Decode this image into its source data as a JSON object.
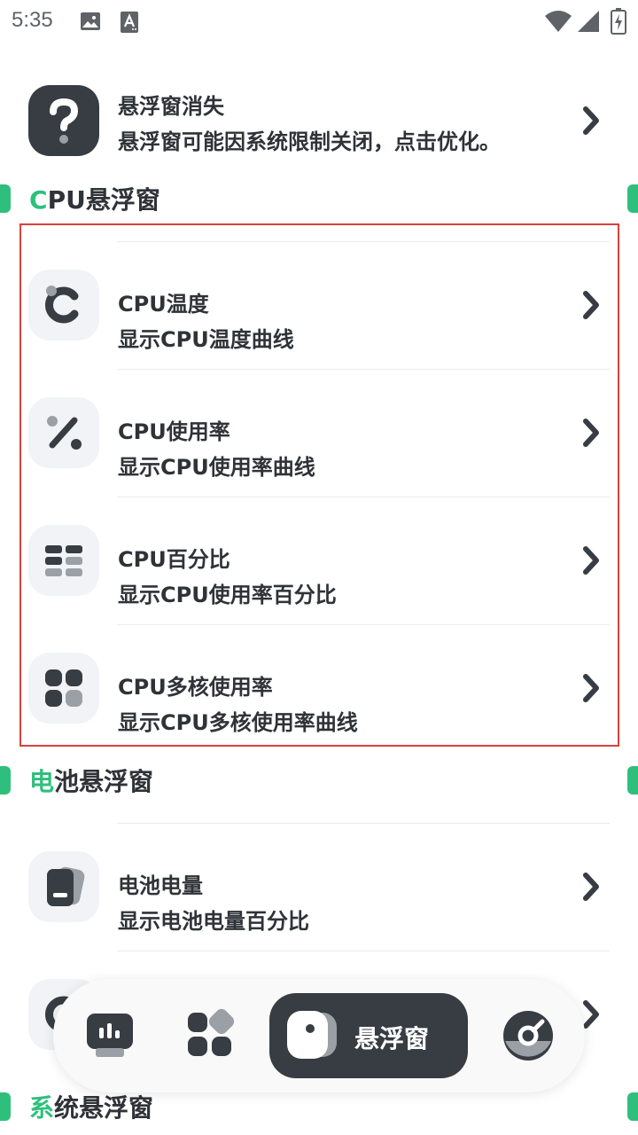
{
  "status_bar": {
    "time": "5:35"
  },
  "top_notice": {
    "title": "悬浮窗消失",
    "subtitle": "悬浮窗可能因系统限制关闭，点击优化。"
  },
  "sections": {
    "cpu": {
      "title_accent": "C",
      "title_rest": "PU悬浮窗",
      "items": [
        {
          "title": "CPU温度",
          "subtitle": "显示CPU温度曲线",
          "icon": "cpu-temperature-icon"
        },
        {
          "title": "CPU使用率",
          "subtitle": "显示CPU使用率曲线",
          "icon": "percent-icon"
        },
        {
          "title": "CPU百分比",
          "subtitle": "显示CPU使用率百分比",
          "icon": "list-grid-icon"
        },
        {
          "title": "CPU多核使用率",
          "subtitle": "显示CPU多核使用率曲线",
          "icon": "multi-core-icon"
        }
      ]
    },
    "battery": {
      "title_accent": "电",
      "title_rest": "池悬浮窗",
      "items": [
        {
          "title": "电池电量",
          "subtitle": "显示电池电量百分比",
          "icon": "battery-icon"
        }
      ]
    },
    "system": {
      "title_accent": "系",
      "title_rest": "统悬浮窗"
    }
  },
  "bottom_nav": {
    "items": [
      {
        "name": "monitor",
        "icon": "monitor-icon"
      },
      {
        "name": "tools",
        "icon": "apps-grid-icon"
      },
      {
        "name": "floating-window",
        "label": "悬浮窗",
        "icon": "floating-window-icon",
        "active": true
      },
      {
        "name": "disc",
        "icon": "disc-icon"
      }
    ]
  },
  "colors": {
    "accent": "#2fbf7d",
    "text": "#2f3338",
    "icon_bg": "#f1f3f7",
    "nav_active_bg": "#383c43",
    "highlight": "#d9413a"
  }
}
